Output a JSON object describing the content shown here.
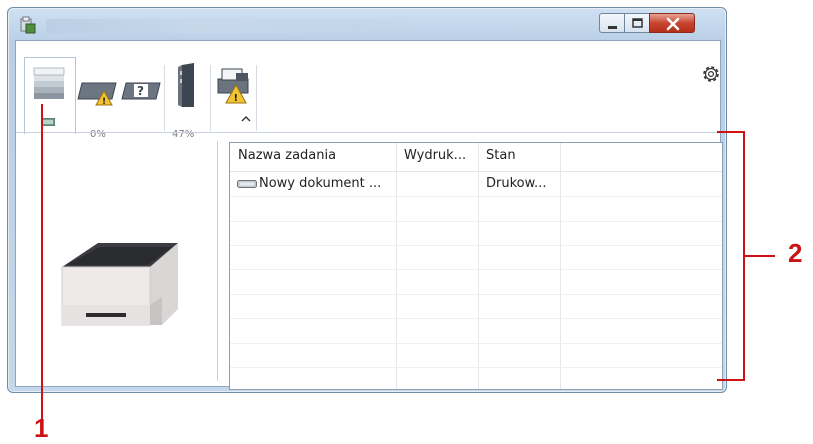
{
  "window": {
    "title": "",
    "controls": [
      "minimize-icon",
      "maximize-icon",
      "close-icon"
    ]
  },
  "tabs": [
    {
      "id": "jobs",
      "icon": "print-queue-icon",
      "label": ""
    },
    {
      "id": "toner",
      "icon": "toner-warning-icon",
      "label": "0%"
    },
    {
      "id": "paper",
      "icon": "paper-tray-icon",
      "label": "47%"
    },
    {
      "id": "device",
      "icon": "device-warning-icon",
      "label": ""
    }
  ],
  "toolbar": {
    "settings_icon": "gear-icon",
    "collapse_icon": "chevron-up-icon"
  },
  "job_list": {
    "columns": [
      "Nazwa zadania",
      "Wydruk...",
      "Stan"
    ],
    "rows": [
      {
        "name": "Nowy dokument ...",
        "printed": "",
        "status": "Drukow...",
        "icon": "document-icon"
      }
    ]
  },
  "callouts": {
    "one": "1",
    "two": "2"
  },
  "colors": {
    "callout": "#cc1212",
    "close_button": "#c7452f",
    "window_frame": "#b9cfe6"
  }
}
